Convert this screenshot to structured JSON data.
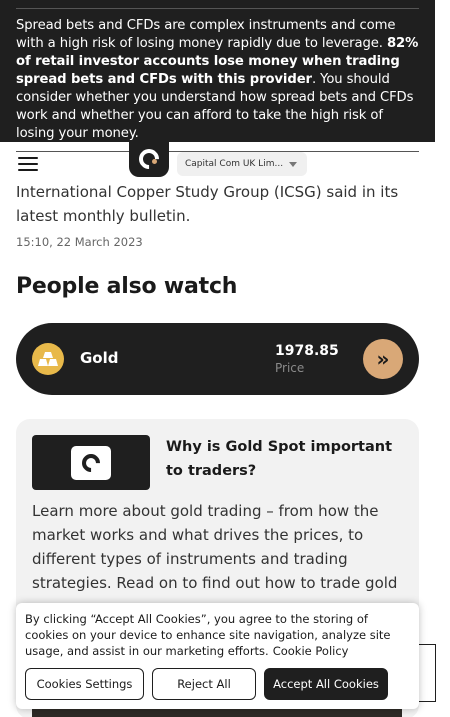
{
  "risk_banner": {
    "text_normal_1": "Spread bets and CFDs are complex instruments and come with a high risk of losing money rapidly due to leverage. ",
    "text_bold": "82% of retail investor accounts lose money when trading spread bets and CFDs with this provider",
    "text_normal_2": ". You should consider whether you understand how spread bets and CFDs work and whether you can afford to take the high risk of losing your money."
  },
  "header": {
    "entity_label": "Capital Com UK Lim...",
    "icons": [
      "hamburger-menu-icon",
      "capital-com-logo",
      "chevron-down-icon"
    ]
  },
  "article": {
    "tail_text": "International Copper Study Group (ICSG) said in its latest monthly bulletin.",
    "date": "15:10, 22 March 2023"
  },
  "people_also_watch": {
    "title": "People also watch",
    "instrument": {
      "name": "Gold",
      "price": "1978.85",
      "price_label": "Price",
      "icon": "gold-bars-icon",
      "action_icon": "double-chevron-right-icon"
    }
  },
  "article_card": {
    "title": "Why is Gold Spot important to traders?",
    "description": "Learn more about gold trading – from how the market works and what drives the prices, to different types of instruments and trading strategies. Read on to find out how to trade gold"
  },
  "cookie_banner": {
    "text": "By clicking “Accept All Cookies”, you agree to the storing of cookies on your device to enhance site navigation, analyze site usage, and assist in our marketing efforts.",
    "policy_link": "Cookie Policy",
    "settings_label": "Cookies Settings",
    "reject_label": "Reject All",
    "accept_label": "Accept All Cookies"
  },
  "colors": {
    "dark": "#1f1f1f",
    "accent_tan": "#d9a877",
    "gold": "#e8b94a",
    "card_bg": "#f2f2f2"
  }
}
